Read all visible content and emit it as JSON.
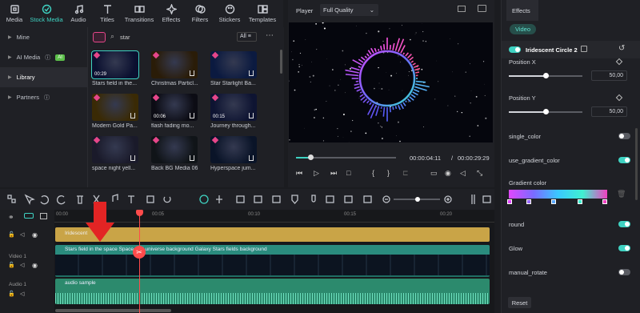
{
  "toolbar_tabs": [
    {
      "label": "Media",
      "icon": "media-icon"
    },
    {
      "label": "Stock Media",
      "icon": "stock-media-icon"
    },
    {
      "label": "Audio",
      "icon": "music-note-icon"
    },
    {
      "label": "Titles",
      "icon": "titles-icon"
    },
    {
      "label": "Transitions",
      "icon": "transitions-icon"
    },
    {
      "label": "Effects",
      "icon": "effects-icon"
    },
    {
      "label": "Filters",
      "icon": "filters-icon"
    },
    {
      "label": "Stickers",
      "icon": "stickers-icon"
    },
    {
      "label": "Templates",
      "icon": "templates-icon"
    }
  ],
  "sidebar": {
    "items": [
      {
        "label": "Mine"
      },
      {
        "label": "AI Media",
        "badge": "AI"
      },
      {
        "label": "Library"
      },
      {
        "label": "Partners"
      }
    ]
  },
  "search": {
    "value": "star",
    "filter_label": "All"
  },
  "media_items": [
    {
      "label": "Stars field in the...",
      "duration": "00:29"
    },
    {
      "label": "Christmas Particl...",
      "duration": ""
    },
    {
      "label": "Star Starlight Ba...",
      "duration": ""
    },
    {
      "label": "Modern Gold Pa...",
      "duration": ""
    },
    {
      "label": "flash fading mo...",
      "duration": "00:06"
    },
    {
      "label": "Journey through...",
      "duration": "00:15"
    },
    {
      "label": "space night yell...",
      "duration": ""
    },
    {
      "label": "Back BG Media 06",
      "duration": ""
    },
    {
      "label": "Hyperspace jum...",
      "duration": ""
    }
  ],
  "player": {
    "label": "Player",
    "quality": "Full Quality",
    "current_time": "00:00:04:11",
    "separator": "/",
    "total_time": "00:00:29:29",
    "progress": 0.14
  },
  "effects": {
    "tab": "Effects",
    "subtab": "Video",
    "effect_name": "Iridescent Circle 2",
    "position_x_label": "Position X",
    "position_x_value": "50,00",
    "position_y_label": "Position Y",
    "position_y_value": "50,00",
    "toggles": [
      {
        "label": "single_color",
        "on": false
      },
      {
        "label": "use_gradient_color",
        "on": true
      }
    ],
    "gradient_label": "Gradient color",
    "toggles2": [
      {
        "label": "round",
        "on": true
      },
      {
        "label": "Glow",
        "on": true
      },
      {
        "label": "manual_rotate",
        "on": false
      }
    ],
    "reset_label": "Reset"
  },
  "timeline": {
    "ruler": [
      "00:00",
      "00:05",
      "00:10",
      "00:15",
      "00:20"
    ],
    "effect_clip": "Iridescent",
    "video_clip": "Stars field in the space  Space and universe background  Galaxy Stars fields background",
    "video_track_label": "Video 1",
    "audio_track_label": "Audio 1",
    "audio_clip": "audio sample"
  }
}
